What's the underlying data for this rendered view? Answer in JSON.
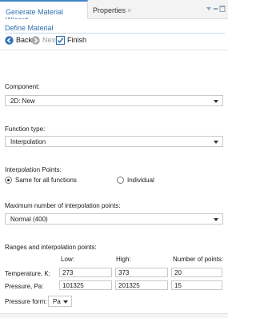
{
  "tabs": {
    "active_label": "Generate Material Wizard",
    "other_label": "Properties",
    "close_glyph": "×"
  },
  "wizard": {
    "title": "Define Material",
    "back_label": "Back",
    "next_label": "Next",
    "finish_label": "Finish"
  },
  "component": {
    "label": "Component:",
    "value": "2D: New"
  },
  "function_type": {
    "label": "Function type:",
    "value": "Interpolation"
  },
  "interpolation_points": {
    "label": "Interpolation Points:",
    "option_same": "Same for all functions",
    "option_individual": "Individual",
    "selected": "Same for all functions"
  },
  "max_points": {
    "label": "Maximum number of interpolation points:",
    "value": "Normal (400)"
  },
  "ranges": {
    "label": "Ranges and interpolation points:",
    "col_low": "Low:",
    "col_high": "High:",
    "col_points": "Number of points:",
    "rows": [
      {
        "label": "Temperature, K:",
        "low": "273",
        "high": "373",
        "points": "20"
      },
      {
        "label": "Pressure, Pa:",
        "low": "101325",
        "high": "201325",
        "points": "15"
      }
    ]
  },
  "pressure_form": {
    "label": "Pressure form:",
    "value": "Pa"
  },
  "colors": {
    "accent": "#2e6fb0",
    "tab_border": "#3f86c7",
    "finish_check": "#2e6fb0",
    "back_icon": "#2f73b8",
    "next_icon_disabled": "#9a9a9a"
  },
  "icons": {
    "back": "back-arrow-icon",
    "next": "next-arrow-icon",
    "finish": "finish-check-icon",
    "minimize": "minimize-icon",
    "maximize": "maximize-icon"
  }
}
